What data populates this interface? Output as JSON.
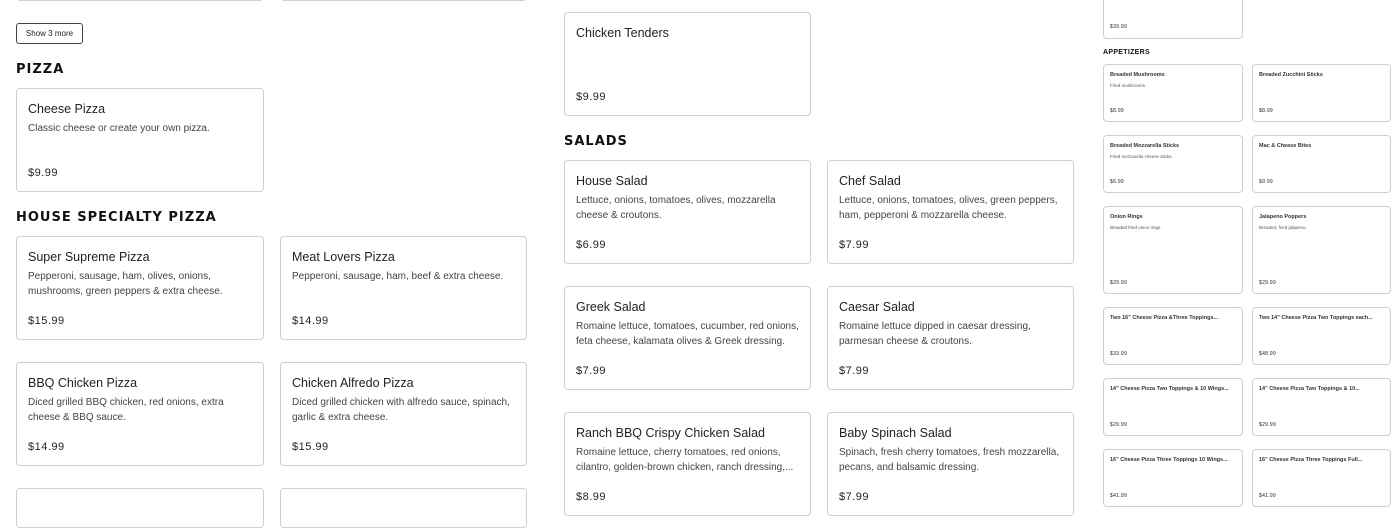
{
  "show_more_label": "Show 3 more",
  "sections": {
    "pizza": "PIZZA",
    "house": "HOUSE SPECIALTY PIZZA",
    "salads": "SALADS",
    "appetizers": "APPETIZERS"
  },
  "col1": [
    {
      "title": "Cheese Pizza",
      "desc": "Classic cheese or create your own pizza.",
      "price": "$9.99"
    },
    {
      "title": "Super Supreme Pizza",
      "desc": "Pepperoni, sausage, ham, olives, onions, mushrooms, green peppers & extra cheese.",
      "price": "$15.99"
    },
    {
      "title": "BBQ Chicken Pizza",
      "desc": "Diced grilled BBQ chicken, red onions, extra cheese & BBQ sauce.",
      "price": "$14.99"
    }
  ],
  "col2": [
    {
      "title": "Meat Lovers Pizza",
      "desc": "Pepperoni, sausage, ham, beef & extra cheese.",
      "price": "$14.99"
    },
    {
      "title": "Chicken Alfredo Pizza",
      "desc": "Diced grilled chicken with alfredo sauce, spinach, garlic & extra cheese.",
      "price": "$15.99"
    }
  ],
  "col3": [
    {
      "title": "Chicken Tenders",
      "desc": "",
      "price": "$9.99"
    },
    {
      "title": "House Salad",
      "desc": "Lettuce, onions, tomatoes, olives, mozzarella cheese & croutons.",
      "price": "$6.99"
    },
    {
      "title": "Greek Salad",
      "desc": "Romaine lettuce, tomatoes, cucumber, red onions, feta cheese, kalamata olives & Greek dressing.",
      "price": "$7.99"
    },
    {
      "title": "Ranch BBQ Crispy Chicken Salad",
      "desc": "Romaine lettuce, cherry tomatoes, red onions, cilantro, golden-brown chicken, ranch dressing,...",
      "price": "$8.99"
    }
  ],
  "col4": [
    {
      "title": "Chef Salad",
      "desc": "Lettuce, onions, tomatoes, olives, green peppers, ham, pepperoni & mozzarella cheese.",
      "price": "$7.99"
    },
    {
      "title": "Caesar Salad",
      "desc": "Romaine lettuce dipped in caesar dressing, parmesan cheese & croutons.",
      "price": "$7.99"
    },
    {
      "title": "Baby Spinach Salad",
      "desc": "Spinach, fresh cherry tomatoes, fresh mozzarella, pecans, and balsamic dressing.",
      "price": "$7.99"
    }
  ],
  "right_top_price": "$39.99",
  "right_a": [
    {
      "title": "Breaded Mushrooms",
      "desc": "Fried mushrooms.",
      "price": "$8.99"
    },
    {
      "title": "Breaded Mozzarella Sticks",
      "desc": "Fried mozzarella cheese sticks.",
      "price": "$6.99"
    },
    {
      "title": "Onion Rings",
      "desc": "Breaded fried onion rings.",
      "price": "$29.99"
    },
    {
      "title": "Two 16\" Cheese Pizza &Three Toppings...",
      "desc": "",
      "price": "$33.99"
    },
    {
      "title": "14\" Cheese Pizza Two Toppings & 10 Wings...",
      "desc": "",
      "price": "$29.99"
    },
    {
      "title": "16\" Cheese Pizza Three Toppings 10 Wings...",
      "desc": "",
      "price": "$41.99"
    }
  ],
  "right_b": [
    {
      "title": "Breaded Zucchini Sticks",
      "desc": "",
      "price": "$8.99"
    },
    {
      "title": "Mac & Cheese Bites",
      "desc": "",
      "price": "$9.99"
    },
    {
      "title": "Jalapeno Poppers",
      "desc": "Breaded, fried jalapeno.",
      "price": "$29.99"
    },
    {
      "title": "Two 14\" Cheese Pizza Two Toppings each...",
      "desc": "",
      "price": "$48.99"
    },
    {
      "title": "14\" Cheese Pizza Two Toppings & 10...",
      "desc": "",
      "price": "$29.99"
    },
    {
      "title": "16\" Cheese Pizza Three Toppings Full...",
      "desc": "",
      "price": "$41.99"
    }
  ]
}
